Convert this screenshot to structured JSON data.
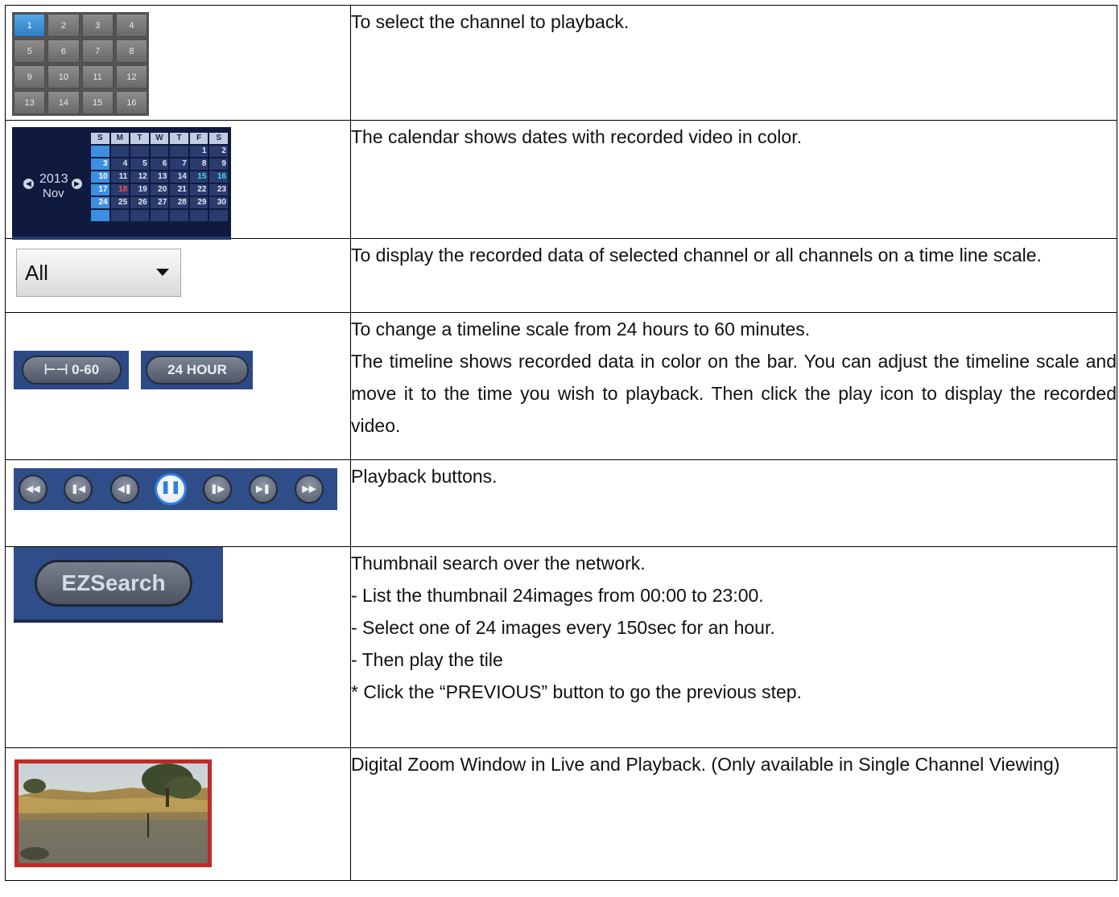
{
  "channel_grid": {
    "selected": "1",
    "channels": [
      "1",
      "2",
      "3",
      "4",
      "5",
      "6",
      "7",
      "8",
      "9",
      "10",
      "11",
      "12",
      "13",
      "14",
      "15",
      "16"
    ]
  },
  "calendar": {
    "year": "2013",
    "month": "Nov",
    "headers": [
      "S",
      "M",
      "T",
      "W",
      "T",
      "F",
      "S"
    ],
    "rows": [
      [
        "",
        "",
        "",
        "",
        "",
        "1",
        "2"
      ],
      [
        "3",
        "4",
        "5",
        "6",
        "7",
        "8",
        "9"
      ],
      [
        "10",
        "11",
        "12",
        "13",
        "14",
        "15",
        "16"
      ],
      [
        "17",
        "18",
        "19",
        "20",
        "21",
        "22",
        "23"
      ],
      [
        "24",
        "25",
        "26",
        "27",
        "28",
        "29",
        "30"
      ],
      [
        "",
        "",
        "",
        "",
        "",
        "",
        ""
      ]
    ]
  },
  "dropdown": {
    "value": "All"
  },
  "timeline_buttons": {
    "scale_label": "0-60",
    "hour_label": "24 HOUR"
  },
  "ezsearch": {
    "label": "EZSearch"
  },
  "rows": [
    {
      "lines": [
        "To select the channel to playback."
      ]
    },
    {
      "lines": [
        "The calendar shows dates with recorded video in color."
      ]
    },
    {
      "lines": [
        "To display the recorded data of selected channel or all channels on a time line scale."
      ]
    },
    {
      "lines": [
        "To change a timeline scale from 24 hours to 60 minutes.",
        "The timeline shows recorded data in color on the bar. You can adjust the timeline scale and move it to the time you wish to playback. Then click the play icon to display the recorded video."
      ]
    },
    {
      "lines": [
        "Playback buttons."
      ]
    },
    {
      "lines": [
        "Thumbnail search over the network.",
        "- List the thumbnail 24images from 00:00 to 23:00.",
        "- Select one of 24 images every 150sec for an hour.",
        "- Then play the tile",
        "* Click the “PREVIOUS” button to go the previous step."
      ]
    },
    {
      "lines": [
        "Digital Zoom Window in Live and Playback. (Only available in Single Channel Viewing)"
      ]
    }
  ]
}
